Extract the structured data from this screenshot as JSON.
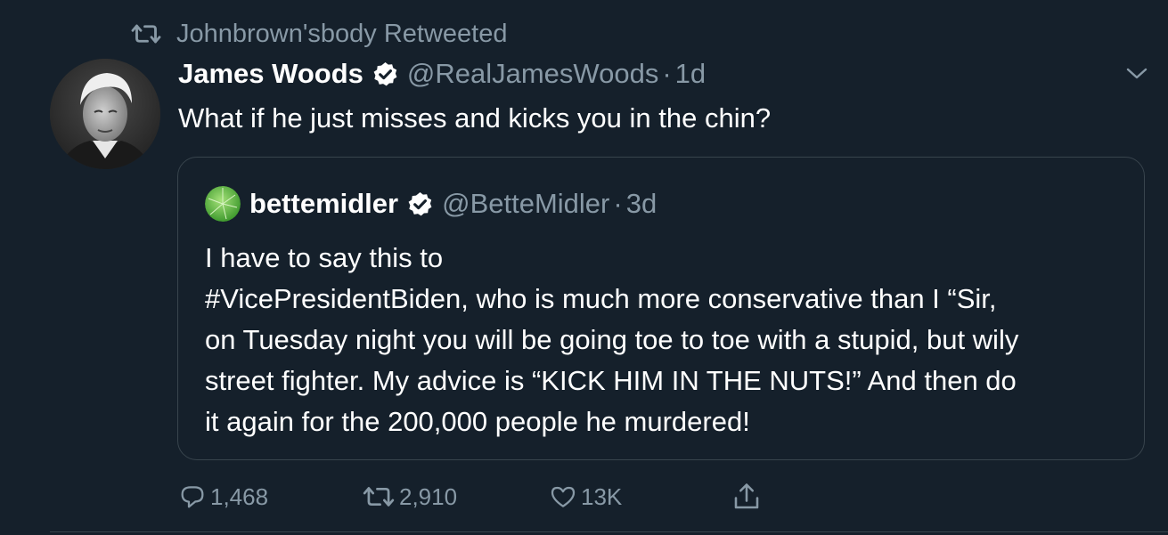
{
  "retweet": {
    "label": "Johnbrown'sbody Retweeted"
  },
  "tweet": {
    "display_name": "James Woods",
    "handle": "@RealJamesWoods",
    "separator": "·",
    "time": "1d",
    "text": "What if he just misses and kicks you in the chin?"
  },
  "quote": {
    "display_name": "bettemidler",
    "handle": "@BetteMidler",
    "separator": "·",
    "time": "3d",
    "lines": [
      "I have to say this to",
      "#VicePresidentBiden, who is much more conservative than I “Sir,",
      "on Tuesday night you will be going toe to toe with a stupid, but wily",
      "street fighter.  My advice is “KICK HIM IN THE NUTS!” And then do",
      "it again for the 200,000 people he murdered!"
    ]
  },
  "actions": {
    "reply_count": "1,468",
    "retweet_count": "2,910",
    "like_count": "13K"
  },
  "icons": {
    "retweet": "retweet-icon",
    "verified": "verified-badge-icon",
    "caret": "chevron-down-icon",
    "reply": "reply-icon",
    "like": "heart-icon",
    "share": "share-icon"
  },
  "colors": {
    "background": "#15202b",
    "muted_text": "#8899a6",
    "border": "#38444d",
    "primary_text": "#ffffff"
  }
}
